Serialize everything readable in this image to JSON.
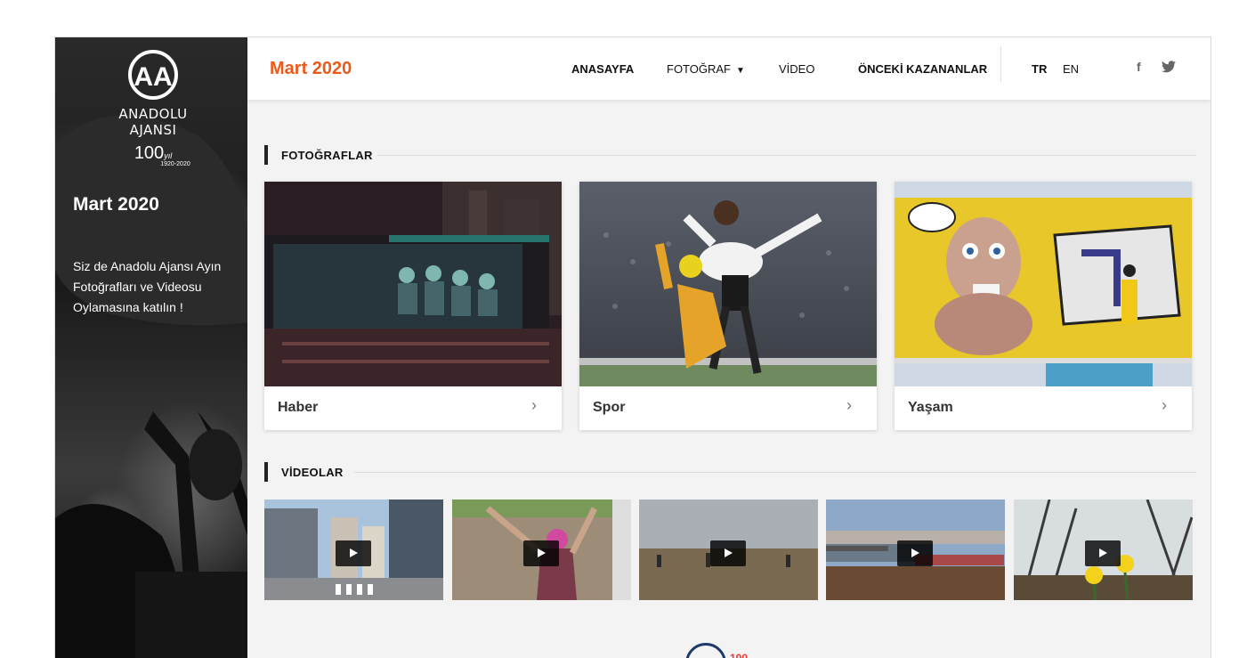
{
  "sidebar": {
    "logo_mark": "AA",
    "logo_name": "ANADOLU AJANSI",
    "logo_hundred": "100",
    "logo_yil": "yıl",
    "logo_years": "1920-2020",
    "title": "Mart 2020",
    "text": "Siz de Anadolu Ajansı Ayın Fotoğrafları ve Videosu Oylamasına katılın !"
  },
  "header": {
    "title": "Mart 2020",
    "nav": {
      "home": "ANASAYFA",
      "photo": "FOTOĞRAF",
      "video": "VİDEO",
      "previous_winners": "ÖNCEKİ KAZANANLAR"
    },
    "lang": {
      "tr": "TR",
      "en": "EN"
    },
    "social": {
      "facebook": "f",
      "twitter": "🐦"
    }
  },
  "photos": {
    "heading": "FOTOĞRAFLAR",
    "cards": [
      {
        "caption": "Haber"
      },
      {
        "caption": "Spor"
      },
      {
        "caption": "Yaşam"
      }
    ]
  },
  "videos": {
    "heading": "VİDEOLAR"
  },
  "footer": {
    "logo_text": "100"
  },
  "colors": {
    "accent": "#ec5a1c",
    "dark": "#111111"
  },
  "icons": {
    "chevron": "›",
    "dropdown": "⌄"
  }
}
